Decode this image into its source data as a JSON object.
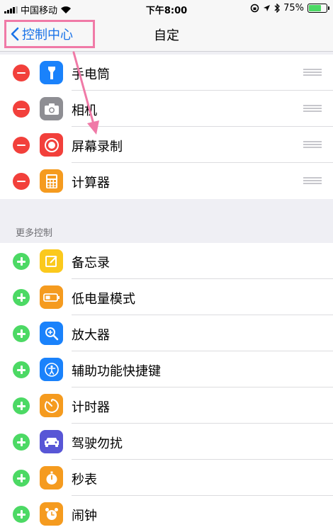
{
  "status_bar": {
    "carrier": "中国移动",
    "time": "下午8:00",
    "battery": "75%",
    "battery_level": 0.75
  },
  "nav": {
    "back_label": "控制中心",
    "title": "自定"
  },
  "included": [
    {
      "label": "手电筒",
      "icon": "flashlight-icon",
      "color": "#1a82fb"
    },
    {
      "label": "相机",
      "icon": "camera-icon",
      "color": "#8e8e93"
    },
    {
      "label": "屏幕录制",
      "icon": "screen-record-icon",
      "color": "#f2403b"
    },
    {
      "label": "计算器",
      "icon": "calculator-icon",
      "color": "#f59b1f"
    }
  ],
  "more": {
    "header": "更多控制",
    "items": [
      {
        "label": "备忘录",
        "icon": "notes-icon",
        "color": "#fbc91d"
      },
      {
        "label": "低电量模式",
        "icon": "low-power-icon",
        "color": "#f59b1f"
      },
      {
        "label": "放大器",
        "icon": "magnifier-icon",
        "color": "#1a82fb"
      },
      {
        "label": "辅助功能快捷键",
        "icon": "accessibility-icon",
        "color": "#1a82fb"
      },
      {
        "label": "计时器",
        "icon": "timer-icon",
        "color": "#f59b1f"
      },
      {
        "label": "驾驶勿扰",
        "icon": "car-icon",
        "color": "#5856d6"
      },
      {
        "label": "秒表",
        "icon": "stopwatch-icon",
        "color": "#f59b1f"
      },
      {
        "label": "闹钟",
        "icon": "alarm-icon",
        "color": "#f59b1f"
      }
    ]
  },
  "colors": {
    "accent": "#1a73e8",
    "highlight": "#f07aa7",
    "remove": "#f2403b",
    "add": "#4cd964"
  }
}
